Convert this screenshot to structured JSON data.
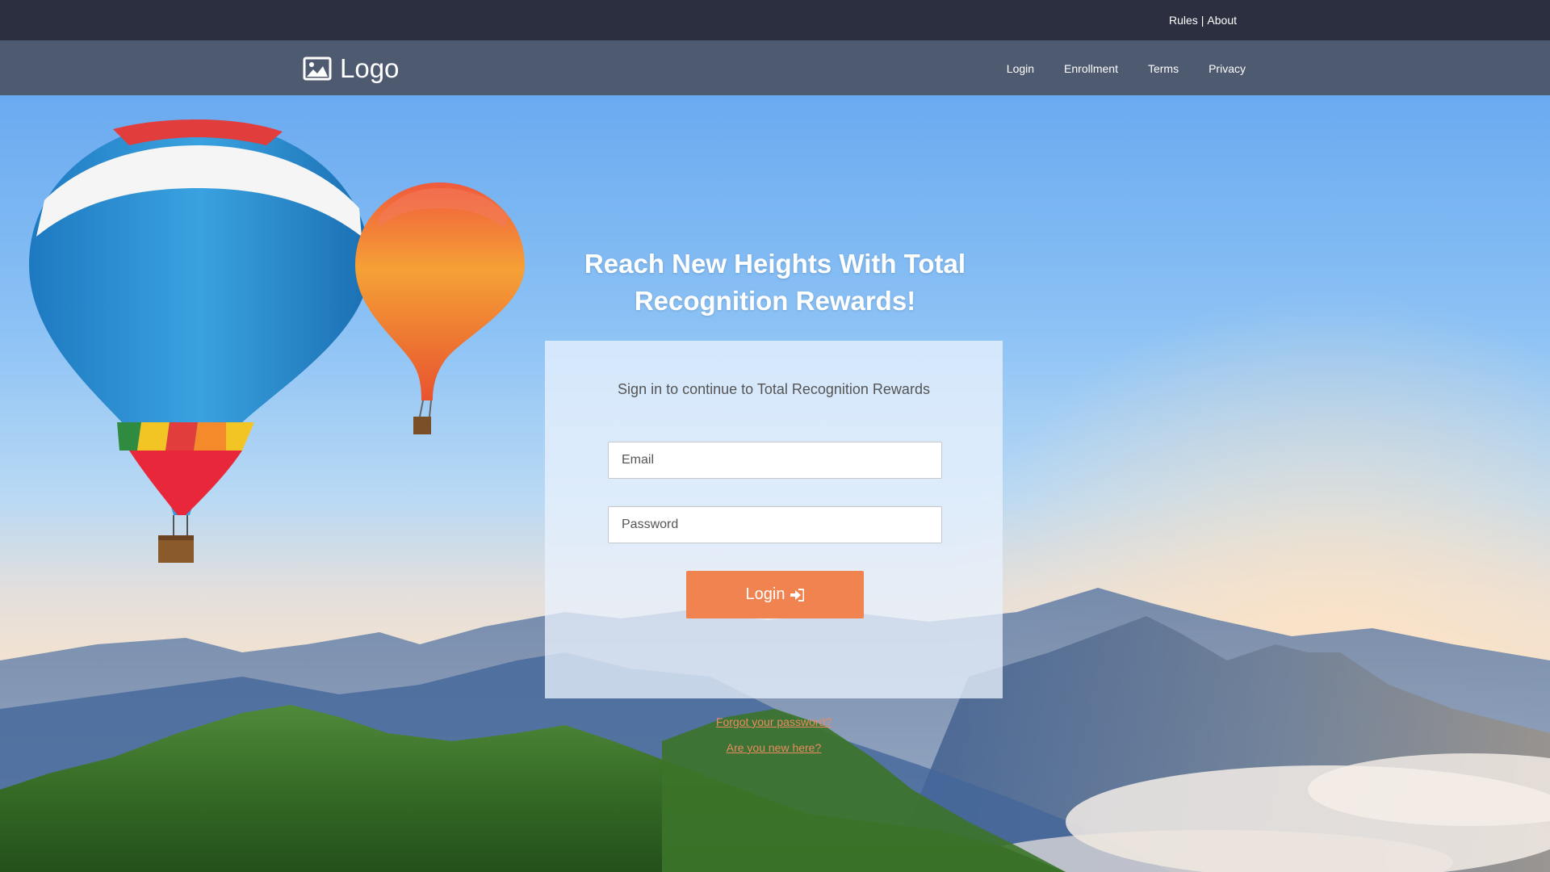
{
  "topbar": {
    "rules_label": "Rules",
    "separator": "|",
    "about_label": "About"
  },
  "navbar": {
    "logo_text": "Logo",
    "logo_icon": "image-icon",
    "links": [
      "Login",
      "Enrollment",
      "Terms",
      "Privacy"
    ]
  },
  "hero": {
    "headline_line1": "Reach New Heights With Total",
    "headline_line2": "Recognition Rewards!",
    "background": "hot-air-balloons-over-mountains"
  },
  "login_card": {
    "subtitle": "Sign in to continue to Total Recognition Rewards",
    "email_placeholder": "Email",
    "password_placeholder": "Password",
    "login_button": "Login",
    "login_button_icon": "sign-in-icon",
    "forgot_password": "Forgot your password?",
    "new_here": "Are you new here?"
  },
  "colors": {
    "topbar": "#2b2f40",
    "navbar": "#4e5a70",
    "accent": "#f0834f",
    "link": "#ea8a5f"
  }
}
